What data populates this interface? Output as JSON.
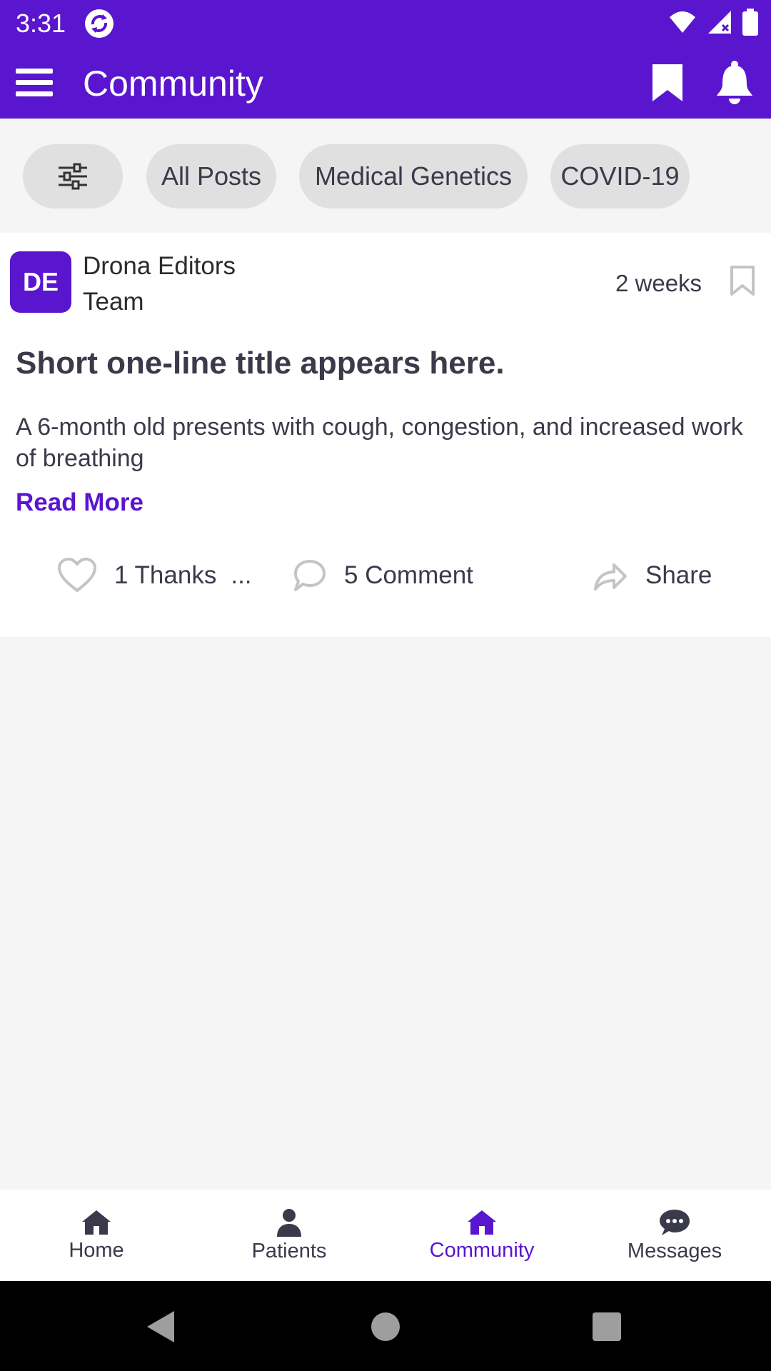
{
  "status_bar": {
    "time": "3:31",
    "icons": [
      "sync-app-icon",
      "wifi-icon",
      "signal-icon",
      "battery-icon"
    ]
  },
  "app_bar": {
    "title": "Community",
    "icons": [
      "menu-icon",
      "bookmark-icon",
      "bell-icon"
    ],
    "background_color": "#5a15cf"
  },
  "filters": {
    "chips": [
      {
        "icon": "sliders-icon",
        "label": ""
      },
      {
        "label": "All Posts"
      },
      {
        "label": "Medical Genetics"
      },
      {
        "label": "COVID-19"
      }
    ]
  },
  "post": {
    "avatar_initials": "DE",
    "author_line1": "Drona Editors",
    "author_line2": "Team",
    "time": "2 weeks",
    "title": "Short one-line title appears here.",
    "body": "A 6-month old presents with cough, congestion, and increased work of breathing",
    "read_more": "Read More",
    "actions": {
      "thanks": "1 Thanks",
      "thanks_more": "...",
      "comment": "5 Comment",
      "share": "Share"
    }
  },
  "bottom_nav": {
    "items": [
      {
        "label": "Home",
        "icon": "home-icon"
      },
      {
        "label": "Patients",
        "icon": "person-icon"
      },
      {
        "label": "Community",
        "icon": "community-home-icon",
        "active": true
      },
      {
        "label": "Messages",
        "icon": "chat-bubble-icon"
      }
    ],
    "active_color": "#5a15cf"
  },
  "system_nav": {
    "icons": [
      "back-icon",
      "home-circle-icon",
      "recents-icon"
    ]
  }
}
